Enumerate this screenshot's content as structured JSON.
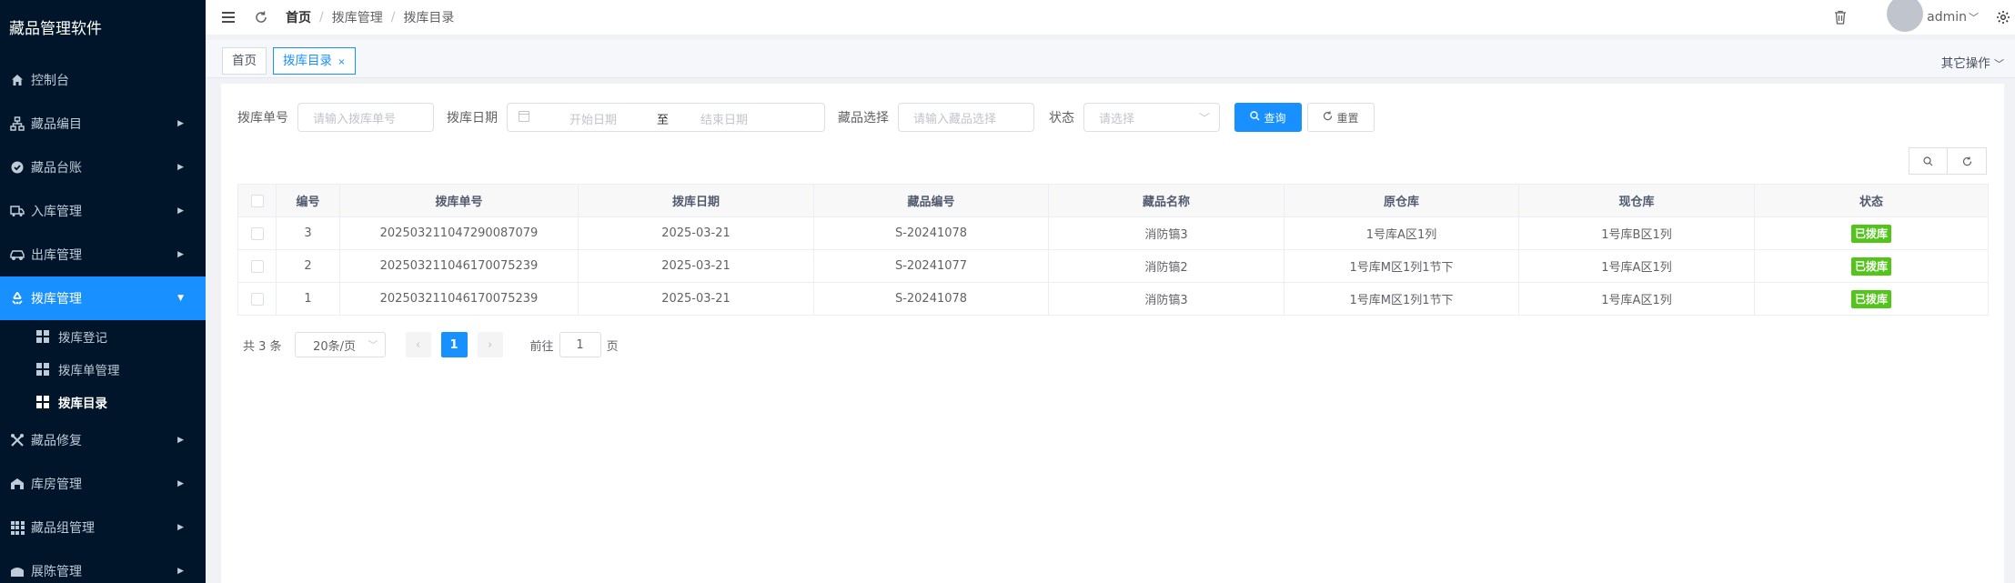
{
  "app": {
    "title": "藏品管理软件"
  },
  "sidebar": {
    "items": [
      {
        "label": "控制台",
        "icon": "home-icon"
      },
      {
        "label": "藏品编目",
        "icon": "tree-icon"
      },
      {
        "label": "藏品台账",
        "icon": "check-circle-icon"
      },
      {
        "label": "入库管理",
        "icon": "truck-icon"
      },
      {
        "label": "出库管理",
        "icon": "car-icon"
      },
      {
        "label": "拨库管理",
        "icon": "recycle-icon"
      },
      {
        "label": "藏品修复",
        "icon": "tools-icon"
      },
      {
        "label": "库房管理",
        "icon": "warehouse-icon"
      },
      {
        "label": "藏品组管理",
        "icon": "grid-icon"
      },
      {
        "label": "展陈管理",
        "icon": "exhibit-icon"
      }
    ],
    "subitems": [
      {
        "label": "拨库登记"
      },
      {
        "label": "拨库单管理"
      },
      {
        "label": "拨库目录"
      }
    ]
  },
  "navbar": {
    "breadcrumb": [
      "首页",
      "拨库管理",
      "拨库目录"
    ],
    "username": "admin"
  },
  "tags": {
    "home": "首页",
    "current": "拨库目录",
    "close": "×",
    "other_ops": "其它操作"
  },
  "filters": {
    "order_no_label": "拨库单号",
    "order_no_placeholder": "请输入拨库单号",
    "date_label": "拨库日期",
    "start_placeholder": "开始日期",
    "range_sep": "至",
    "end_placeholder": "结束日期",
    "item_label": "藏品选择",
    "item_placeholder": "请输入藏品选择",
    "status_label": "状态",
    "status_placeholder": "请选择",
    "search_btn": "查询",
    "reset_btn": "重置"
  },
  "table": {
    "headers": [
      "编号",
      "拨库单号",
      "拨库日期",
      "藏品编号",
      "藏品名称",
      "原仓库",
      "现仓库",
      "状态"
    ],
    "rows": [
      {
        "id": "3",
        "order_no": "20250321104729008707​9",
        "date": "2025-03-21",
        "code": "S-20241078",
        "name": "消防镐3",
        "from": "1号库A区1列",
        "to": "1号库B区1列",
        "status": "已拨库"
      },
      {
        "id": "2",
        "order_no": "202503211046170075239",
        "date": "2025-03-21",
        "code": "S-20241077",
        "name": "消防镐2",
        "from": "1号库M区1列1节下",
        "to": "1号库A区1列",
        "status": "已拨库"
      },
      {
        "id": "1",
        "order_no": "202503211046170075239",
        "date": "2025-03-21",
        "code": "S-20241078",
        "name": "消防镐3",
        "from": "1号库M区1列1节下",
        "to": "1号库A区1列",
        "status": "已拨库"
      }
    ]
  },
  "pagination": {
    "total": "共 3 条",
    "page_size": "20条/页",
    "current": "1",
    "goto_label": "前往",
    "goto_value": "1",
    "page_suffix": "页"
  },
  "colors": {
    "sidebar_bg": "#001529",
    "accent": "#1890ff",
    "success": "#52c41a"
  }
}
